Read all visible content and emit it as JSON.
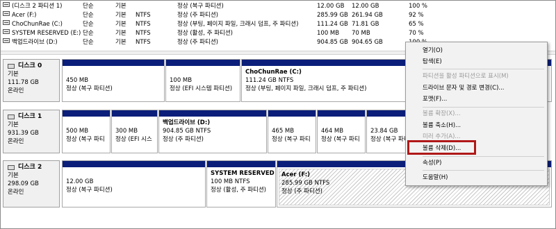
{
  "volumes": [
    {
      "name": "(디스크 2 파티션 1)",
      "layout": "단순",
      "type": "기본",
      "fs": "",
      "status": "정상 (복구 파티션)",
      "capacity": "12.00 GB",
      "free": "12.00 GB",
      "pct": "100 %"
    },
    {
      "name": "Acer (F:)",
      "layout": "단순",
      "type": "기본",
      "fs": "NTFS",
      "status": "정상 (주 파티션)",
      "capacity": "285.99 GB",
      "free": "261.94 GB",
      "pct": "92 %"
    },
    {
      "name": "ChoChunRae (C:)",
      "layout": "단순",
      "type": "기본",
      "fs": "NTFS",
      "status": "정상 (부팅, 페이지 파일, 크래시 덤프, 주 파티션)",
      "capacity": "111.24 GB",
      "free": "71.81 GB",
      "pct": "65 %"
    },
    {
      "name": "SYSTEM RESERVED (E:)",
      "layout": "단순",
      "type": "기본",
      "fs": "NTFS",
      "status": "정상 (활성, 주 파티션)",
      "capacity": "100 MB",
      "free": "70 MB",
      "pct": "70 %"
    },
    {
      "name": "백업드라이브 (D:)",
      "layout": "단순",
      "type": "기본",
      "fs": "NTFS",
      "status": "정상 (주 파티션)",
      "capacity": "904.85 GB",
      "free": "904.65 GB",
      "pct": "100 %"
    }
  ],
  "disks": [
    {
      "name": "디스크 0",
      "type": "기본",
      "size": "111.78 GB",
      "state": "온라인",
      "partitions": [
        {
          "label": "",
          "size": "450 MB",
          "status": "정상 (복구 파티션)"
        },
        {
          "label": "",
          "size": "100 MB",
          "status": "정상 (EFI 시스템 파티션)"
        },
        {
          "label": "ChoChunRae  (C:)",
          "size": "111.24 GB NTFS",
          "status": "정상 (부팅, 페이지 파일, 크래시 덤프, 주 파티션)"
        }
      ]
    },
    {
      "name": "디스크 1",
      "type": "기본",
      "size": "931.39 GB",
      "state": "온라인",
      "partitions": [
        {
          "label": "",
          "size": "500 MB",
          "status": "정상 (복구 파티"
        },
        {
          "label": "",
          "size": "300 MB",
          "status": "정상 (EFI 시스"
        },
        {
          "label": "백업드라이브  (D:)",
          "size": "904.85 GB NTFS",
          "status": "정상 (주 파티션)"
        },
        {
          "label": "",
          "size": "465 MB",
          "status": "정상 (복구 파티"
        },
        {
          "label": "",
          "size": "464 MB",
          "status": "정상 (복구 파티"
        },
        {
          "label": "",
          "size": "23.84 GB",
          "status": "정상 (복구 파티"
        }
      ]
    },
    {
      "name": "디스크 2",
      "type": "기본",
      "size": "298.09 GB",
      "state": "온라인",
      "partitions": [
        {
          "label": "",
          "size": "12.00 GB",
          "status": "정상 (복구 파티션)"
        },
        {
          "label": "SYSTEM RESERVED  (",
          "size": "100 MB NTFS",
          "status": "정상 (활성, 주 파티션)"
        },
        {
          "label": "Acer  (F:)",
          "size": "285.99 GB NTFS",
          "status": "정상 (주 파티션)"
        }
      ]
    }
  ],
  "context_menu": {
    "open": "열기(O)",
    "explore": "탐색(E)",
    "mark_active": "파티션을 활성 파티션으로 표시(M)",
    "change_letter": "드라이브 문자 및 경로 변경(C)...",
    "format": "포맷(F)...",
    "extend": "볼륨 확장(X)...",
    "shrink": "볼륨 축소(H)...",
    "add_mirror": "미러 추가(A)...",
    "delete": "볼륨 삭제(D)...",
    "properties": "속성(P)",
    "help": "도움말(H)"
  },
  "colors": {
    "partition_bar": "#0a1e7a",
    "highlight": "#b01818"
  }
}
